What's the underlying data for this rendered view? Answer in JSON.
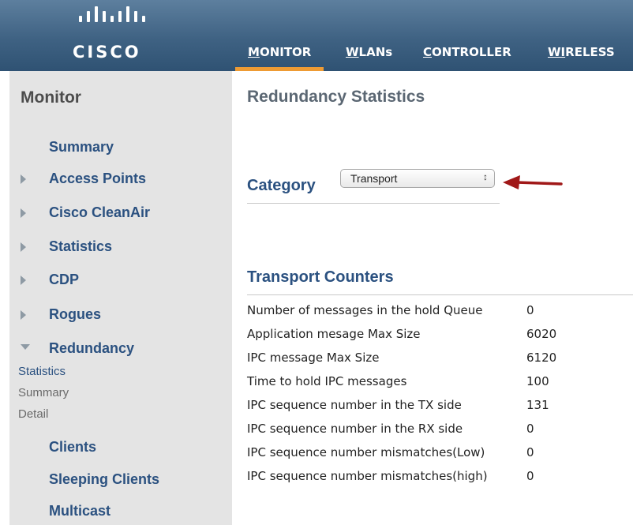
{
  "header": {
    "logo_text": "CISCO",
    "nav": [
      {
        "label": "MONITOR",
        "accel": "M",
        "rest": "ONITOR",
        "active": true
      },
      {
        "label": "WLANs",
        "accel": "W",
        "rest": "LANs"
      },
      {
        "label": "CONTROLLER",
        "accel": "C",
        "rest": "ONTROLLER"
      },
      {
        "label": "WIRELESS",
        "accel": "WI",
        "rest": "RELESS"
      }
    ]
  },
  "sidebar": {
    "title": "Monitor",
    "items": [
      {
        "label": "Summary"
      },
      {
        "label": "Access Points"
      },
      {
        "label": "Cisco CleanAir"
      },
      {
        "label": "Statistics"
      },
      {
        "label": "CDP"
      },
      {
        "label": "Rogues"
      },
      {
        "label": "Redundancy"
      },
      {
        "label": "Clients"
      },
      {
        "label": "Sleeping Clients"
      },
      {
        "label": "Multicast"
      }
    ],
    "redundancy_sub": [
      {
        "label": "Statistics"
      },
      {
        "label": "Summary"
      },
      {
        "label": "Detail"
      }
    ]
  },
  "main": {
    "title": "Redundancy Statistics",
    "category_label": "Category",
    "category_value": "Transport",
    "section_title": "Transport Counters",
    "counters": [
      {
        "label": "Number of messages in the hold Queue",
        "value": "0"
      },
      {
        "label": "Application mesage Max Size",
        "value": "6020"
      },
      {
        "label": "IPC message Max Size",
        "value": "6120"
      },
      {
        "label": "Time to hold IPC messages",
        "value": "100"
      },
      {
        "label": "IPC sequence number in the TX side",
        "value": "131"
      },
      {
        "label": "IPC sequence number in the RX side",
        "value": "0"
      },
      {
        "label": "IPC sequence number mismatches(Low)",
        "value": "0"
      },
      {
        "label": "IPC sequence number mismatches(high)",
        "value": "0"
      }
    ]
  },
  "colors": {
    "header_bg": "#3f6283",
    "active_tab_underline": "#ee9b34",
    "link_blue": "#2b5180",
    "sidebar_bg": "#e4e4e4",
    "annotation_arrow": "#a01818"
  },
  "icons": {
    "expand": "triangle-right-icon",
    "collapse": "triangle-down-icon",
    "select": "select-arrows-icon",
    "annotation": "red-arrow-icon"
  }
}
